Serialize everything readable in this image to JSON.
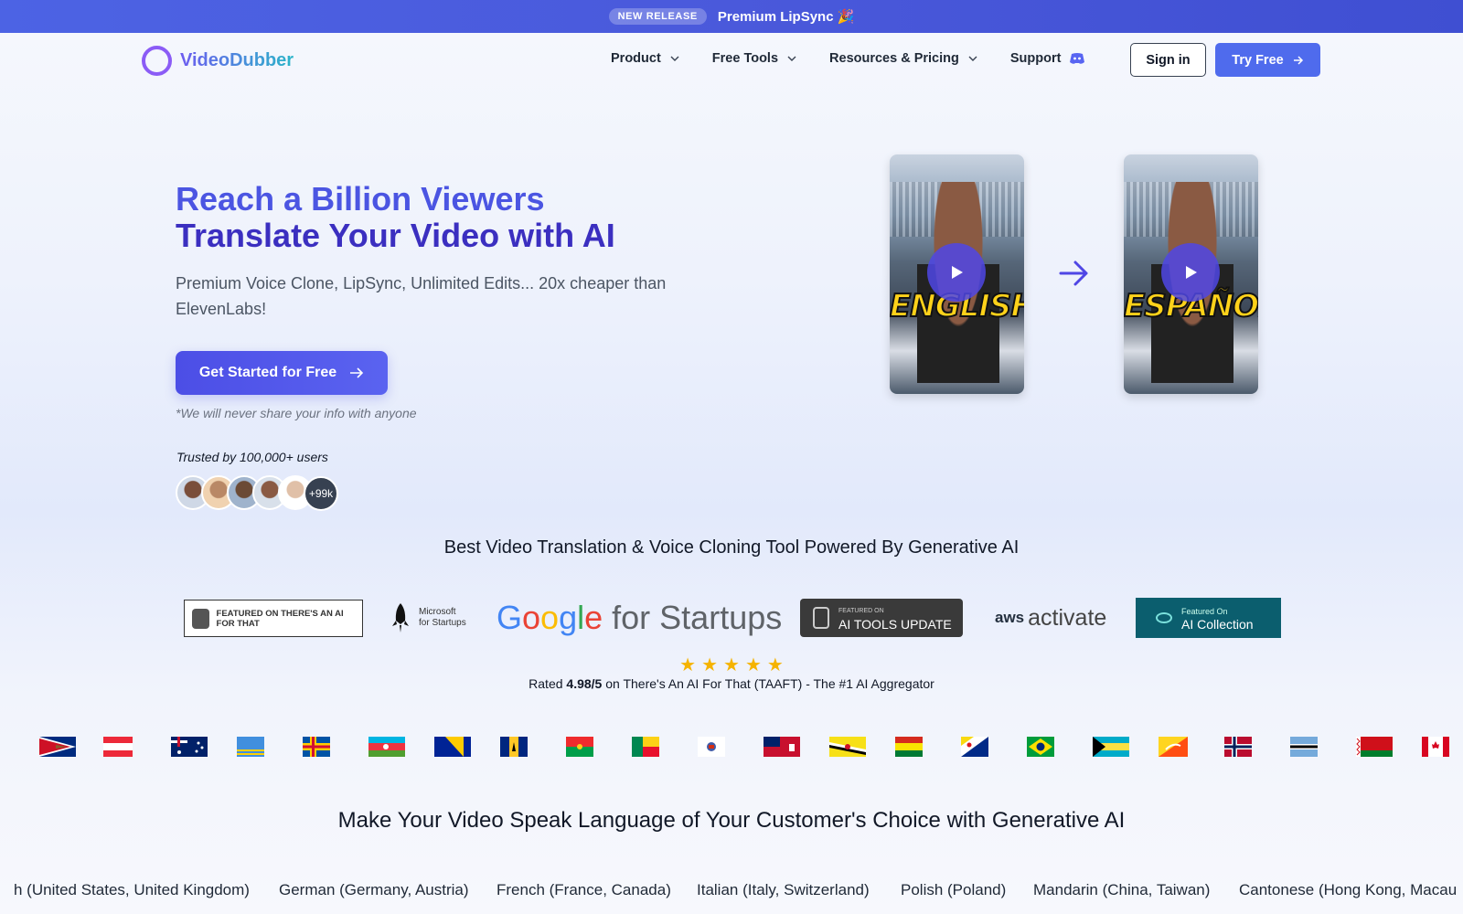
{
  "announcement": {
    "badge": "NEW RELEASE",
    "title": "Premium LipSync 🎉"
  },
  "nav": {
    "logo_text": "VideoDubber",
    "items": [
      {
        "label": "Product",
        "has_dropdown": true
      },
      {
        "label": "Free Tools",
        "has_dropdown": true
      },
      {
        "label": "Resources & Pricing",
        "has_dropdown": true
      },
      {
        "label": "Support",
        "has_dropdown": false,
        "icon": "discord-icon"
      }
    ],
    "sign_in": "Sign in",
    "try_free": "Try Free"
  },
  "hero": {
    "title_line1": "Reach a Billion Viewers",
    "title_line2": "Translate Your Video with AI",
    "subtitle": "Premium Voice Clone, LipSync, Unlimited Edits... 20x cheaper than ElevenLabs!",
    "cta": "Get Started for Free",
    "note": "*We will never share your info with anyone",
    "trusted": "Trusted by 100,000+ users",
    "avatar_more": "+99k"
  },
  "videos": [
    {
      "caption": "ENGLISH"
    },
    {
      "caption": "ESPAÑOL"
    }
  ],
  "tagline": "Best Video Translation & Voice Cloning Tool Powered By Generative AI",
  "logos": {
    "taaft": "FEATURED ON THERE'S AN AI FOR THAT",
    "microsoft": "Microsoft for Startups",
    "google_suffix": "for Startups",
    "ai_tools_small": "FEATURED ON",
    "ai_tools": "AI TOOLS UPDATE",
    "aws_prefix": "aws",
    "aws": "activate",
    "ai_collection_small": "Featured On",
    "ai_collection": "AI Collection"
  },
  "rating": {
    "stars": 5,
    "prefix": "Rated ",
    "score": "4.98/5",
    "suffix": " on There's An AI For That (TAAFT) - The #1 AI Aggregator"
  },
  "section_title": "Make Your Video Speak Language of Your Customer's Choice with Generative AI",
  "languages": [
    "h (United States, United Kingdom)",
    "German (Germany, Austria)",
    "French (France, Canada)",
    "Italian (Italy, Switzerland)",
    "Polish (Poland)",
    "Mandarin (China, Taiwan)",
    "Cantonese (Hong Kong, Macau"
  ],
  "colors": {
    "brand": "#4b55e2",
    "brand_dark": "#3b2fc0",
    "accent_button": "#4f6bed",
    "star": "#f5b301"
  }
}
